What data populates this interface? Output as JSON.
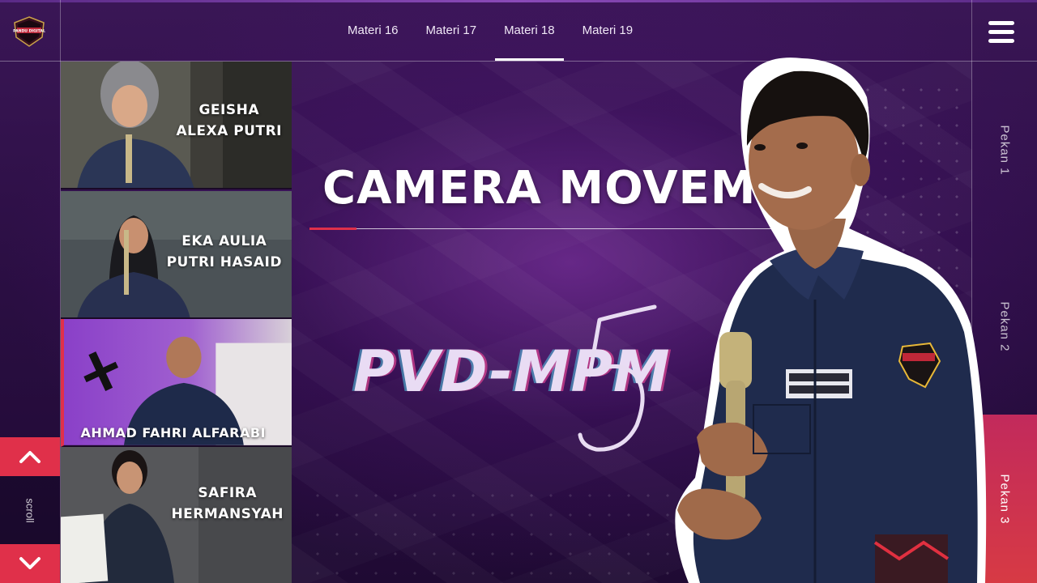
{
  "nav": {
    "items": [
      {
        "label": "Materi 16",
        "active": false
      },
      {
        "label": "Materi 17",
        "active": false
      },
      {
        "label": "Materi 18",
        "active": true
      },
      {
        "label": "Materi 19",
        "active": false
      }
    ]
  },
  "logo": {
    "text": "PANDU DIGITAL"
  },
  "weeks": [
    {
      "label": "Pekan 1",
      "active": false
    },
    {
      "label": "Pekan 2",
      "active": false
    },
    {
      "label": "Pekan 3",
      "active": true
    }
  ],
  "scroll": {
    "label": "scroll"
  },
  "participants": [
    {
      "name": "GEISHA\nALEXA PUTRI"
    },
    {
      "name": "EKA AULIA\nPUTRI HASAID"
    },
    {
      "name": "AHMAD FAHRI ALFARABI"
    },
    {
      "name": "SAFIRA\nHERMANSYAH"
    }
  ],
  "main": {
    "title": "CAMERA MOVEMENT",
    "event_name": "PVD-MPM",
    "event_number": "5"
  },
  "colors": {
    "accent": "#e0304a",
    "background": "#2a0f3e",
    "jacket": "#1e2a4a"
  }
}
